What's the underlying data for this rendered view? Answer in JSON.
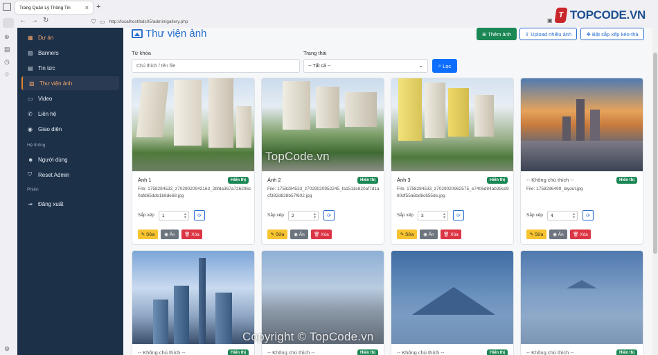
{
  "browser": {
    "tab_title": "Trang Quản Lý Thông Tin",
    "url": "http://localhost/bds05/admin/gallery.php"
  },
  "brand": {
    "logo_text": "TOPCODE",
    "logo_suffix": ".VN"
  },
  "sidebar": {
    "items": [
      {
        "label": "Dự án",
        "icon": "building-icon",
        "active": true
      },
      {
        "label": "Banners",
        "icon": "image-icon",
        "active": false
      },
      {
        "label": "Tin tức",
        "icon": "newspaper-icon",
        "active": false
      },
      {
        "label": "Thư viện ảnh",
        "icon": "images-icon",
        "active": true
      },
      {
        "label": "Video",
        "icon": "camera-video-icon",
        "active": false
      },
      {
        "label": "Liên hệ",
        "icon": "phone-icon",
        "active": false
      },
      {
        "label": "Giao diện",
        "icon": "palette-icon",
        "active": false
      }
    ],
    "section_system": "Hệ thống",
    "system_items": [
      {
        "label": "Người dùng",
        "icon": "people-icon"
      },
      {
        "label": "Reset Admin",
        "icon": "shield-icon"
      }
    ],
    "section_session": "Phiên",
    "session_items": [
      {
        "label": "Đăng xuất",
        "icon": "logout-icon"
      }
    ]
  },
  "main": {
    "title": "Thư viện ảnh",
    "buttons": {
      "add": "Thêm ảnh",
      "upload": "Upload nhiều ảnh",
      "sort_drag": "Bật sắp xếp kéo-thả"
    },
    "filter": {
      "keyword_label": "Từ khóa",
      "keyword_placeholder": "Chú thích / tên file",
      "status_label": "Trạng thái",
      "status_value": "-- Tất cả --",
      "filter_button": "Lọc"
    },
    "cards": [
      {
        "caption": "Ảnh 1",
        "status": "Hiển thị",
        "file": "File: 1758284533_z7029020942163_2bfda367a726296c0afd65dde1b8de68.jpg",
        "sort": "1"
      },
      {
        "caption": "Ảnh 2",
        "status": "Hiển thị",
        "file": "File: 1758284533_z7029020952245_fa1511e820af7d1acf382d828b57f602.jpg",
        "sort": "2"
      },
      {
        "caption": "Ảnh 3",
        "status": "Hiển thị",
        "file": "File: 1758284533_z7029020962575_e7406d84ab39cd980df55a6bd8c655de.jpg",
        "sort": "3"
      },
      {
        "caption": "-- Không chú thích --",
        "status": "Hiển thị",
        "file": "File: 1758296499_layout.jpg",
        "sort": "4"
      },
      {
        "caption": "-- Không chú thích --",
        "status": "Hiển thị",
        "file": "",
        "sort": ""
      },
      {
        "caption": "-- Không chú thích --",
        "status": "Hiển thị",
        "file": "",
        "sort": ""
      },
      {
        "caption": "-- Không chú thích --",
        "status": "Hiển thị",
        "file": "",
        "sort": ""
      },
      {
        "caption": "-- Không chú thích --",
        "status": "Hiển thị",
        "file": "",
        "sort": ""
      }
    ],
    "sort_label": "Sắp xếp",
    "actions": {
      "edit": "Sửa",
      "hide": "Ẩn",
      "delete": "Xóa"
    }
  },
  "watermarks": {
    "center": "TopCode.vn",
    "bottom": "Copyright © TopCode.vn"
  },
  "colors": {
    "sidebar_bg": "#1c3048",
    "accent": "#2a6fcf",
    "success": "#1a8754",
    "warning": "#f7c32e",
    "danger": "#dc3545"
  }
}
